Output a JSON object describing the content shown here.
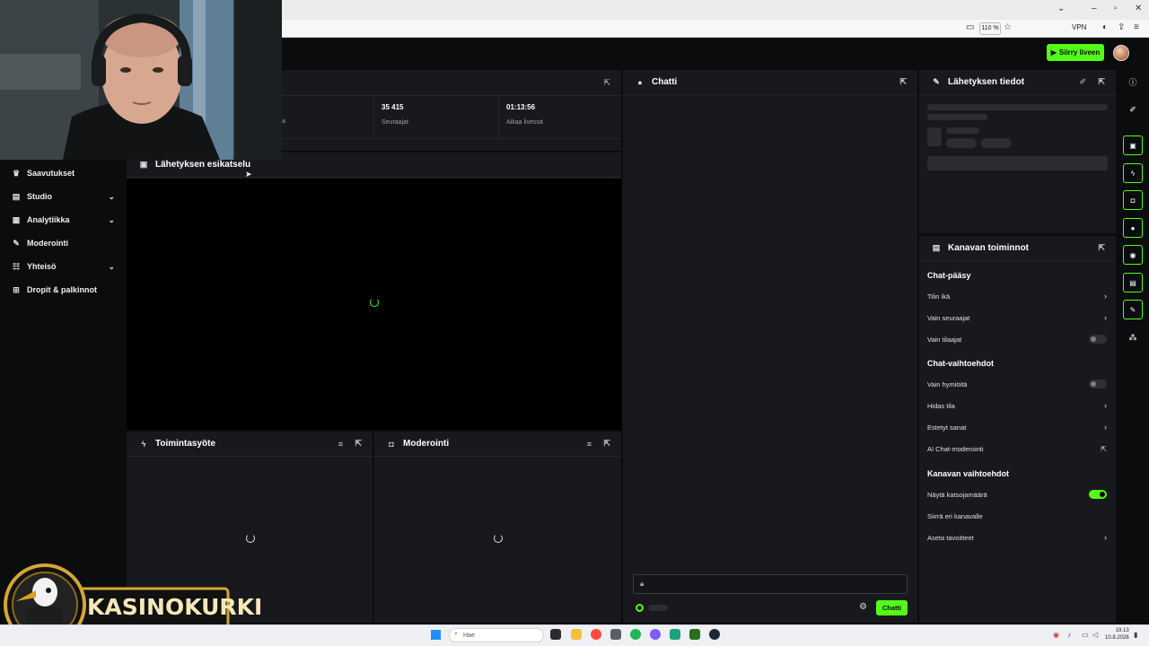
{
  "browser": {
    "zoom": "110 %",
    "vpn": "VPN"
  },
  "topbar": {
    "go_live": "Siirry liveen"
  },
  "sidebar": {
    "items": [
      {
        "label": "Saavutukset",
        "icon": "trophy-icon",
        "expand": false
      },
      {
        "label": "Studio",
        "icon": "studio-icon",
        "expand": true
      },
      {
        "label": "Analytiikka",
        "icon": "analytics-icon",
        "expand": true
      },
      {
        "label": "Moderointi",
        "icon": "wrench-icon",
        "expand": false
      },
      {
        "label": "Yhteisö",
        "icon": "community-icon",
        "expand": true
      },
      {
        "label": "Dropit & palkinnot",
        "icon": "gift-icon",
        "expand": false
      }
    ]
  },
  "stats": {
    "partial_label": "a",
    "followers_value": "35 415",
    "followers_label": "Seuraajat",
    "live_value": "01:13:56",
    "live_label": "Aikaa livessä"
  },
  "preview": {
    "title": "Lähetyksen esikatselu"
  },
  "activity": {
    "title": "Toimintasyöte"
  },
  "moderation": {
    "title": "Moderointi"
  },
  "chat": {
    "title": "Chatti",
    "send_label": "Chatti"
  },
  "stream_info": {
    "title": "Lähetyksen tiedot"
  },
  "channel_actions": {
    "title": "Kanavan toiminnot",
    "chat_access": {
      "title": "Chat-pääsy",
      "items": [
        "Tilin ikä",
        "Vain seuraajat",
        "Vain tilaajat"
      ]
    },
    "chat_options": {
      "title": "Chat-vaihtoehdot",
      "items": [
        "Vain hymiöitä",
        "Hidas tila",
        "Estetyt sanat",
        "AI Chat-moderointi"
      ]
    },
    "channel_options": {
      "title": "Kanavan vaihtoehdot",
      "items": [
        "Näytä katsojamäärä",
        "Siirrä eri kanavalle",
        "Aseta tavoitteet"
      ]
    },
    "toggles": {
      "subscribers_only": false,
      "emotes_only": false,
      "show_viewer_count": true
    }
  },
  "taskbar": {
    "search_placeholder": "Hae",
    "time": "19.13",
    "date": "10.8.2026"
  },
  "overlay": {
    "logo_text": "KASINOKURKI"
  },
  "colors": {
    "accent": "#53fc18",
    "panel": "#18191c",
    "background": "#0b0c0e"
  }
}
